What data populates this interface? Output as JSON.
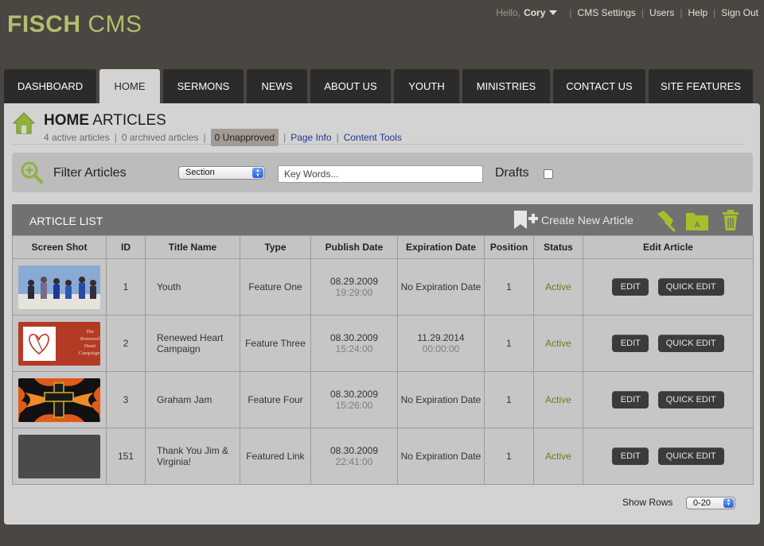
{
  "header": {
    "logo_bold": "FISCH",
    "logo_light": "CMS",
    "greeting": "Hello,",
    "user_name": "Cory",
    "links": [
      "CMS Settings",
      "Users",
      "Help",
      "Sign Out"
    ]
  },
  "tabs": [
    {
      "label": "DASHBOARD",
      "active": false
    },
    {
      "label": "HOME",
      "active": true
    },
    {
      "label": "SERMONS",
      "active": false
    },
    {
      "label": "NEWS",
      "active": false
    },
    {
      "label": "ABOUT US",
      "active": false
    },
    {
      "label": "YOUTH",
      "active": false
    },
    {
      "label": "MINISTRIES",
      "active": false
    },
    {
      "label": "CONTACT US",
      "active": false
    },
    {
      "label": "SITE FEATURES",
      "active": false
    }
  ],
  "page": {
    "title_bold": "HOME",
    "title_light": "ARTICLES",
    "active_count": "4 active articles",
    "archived_count": "0 archived articles",
    "unapproved": "0 Unapproved",
    "page_info_link": "Page Info",
    "content_tools_link": "Content Tools"
  },
  "filter": {
    "label": "Filter Articles",
    "section_value": "Section",
    "keywords_placeholder": "Key Words...",
    "drafts_label": "Drafts"
  },
  "list": {
    "title": "ARTICLE LIST",
    "create_label": "Create New Article",
    "columns": [
      "Screen Shot",
      "ID",
      "Title Name",
      "Type",
      "Publish Date",
      "Expiration Date",
      "Position",
      "Status",
      "Edit Article"
    ],
    "edit_label": "EDIT",
    "quick_edit_label": "QUICK EDIT",
    "rows": [
      {
        "thumb": "youth-photo",
        "id": "1",
        "title": "Youth",
        "type": "Feature One",
        "publish_date": "08.29.2009",
        "publish_time": "19:29:00",
        "expiration": "No Expiration Date",
        "expiration_time": "",
        "position": "1",
        "status": "Active"
      },
      {
        "thumb": "renewed-heart",
        "thumb_text": "The Renewed Heart Campaign",
        "id": "2",
        "title": "Renewed Heart Campaign",
        "type": "Feature Three",
        "publish_date": "08.30.2009",
        "publish_time": "15:24:00",
        "expiration": "11.29.2014",
        "expiration_time": "00:00:00",
        "position": "1",
        "status": "Active"
      },
      {
        "thumb": "flame-cross",
        "id": "3",
        "title": "Graham Jam",
        "type": "Feature Four",
        "publish_date": "08.30.2009",
        "publish_time": "15:26:00",
        "expiration": "No Expiration Date",
        "expiration_time": "",
        "position": "1",
        "status": "Active"
      },
      {
        "thumb": "empty",
        "id": "151",
        "title": "Thank You Jim & Virginia!",
        "type": "Featured Link",
        "publish_date": "08.30.2009",
        "publish_time": "22:41:00",
        "expiration": "No Expiration Date",
        "expiration_time": "",
        "position": "1",
        "status": "Active"
      }
    ]
  },
  "footer": {
    "show_rows_label": "Show Rows",
    "rows_value": "0-20"
  },
  "colors": {
    "accent": "#b4bd6e",
    "active_status": "#6c7c1b",
    "link": "#23378e",
    "background": "#4a4641",
    "panel": "#d3d3d3"
  }
}
